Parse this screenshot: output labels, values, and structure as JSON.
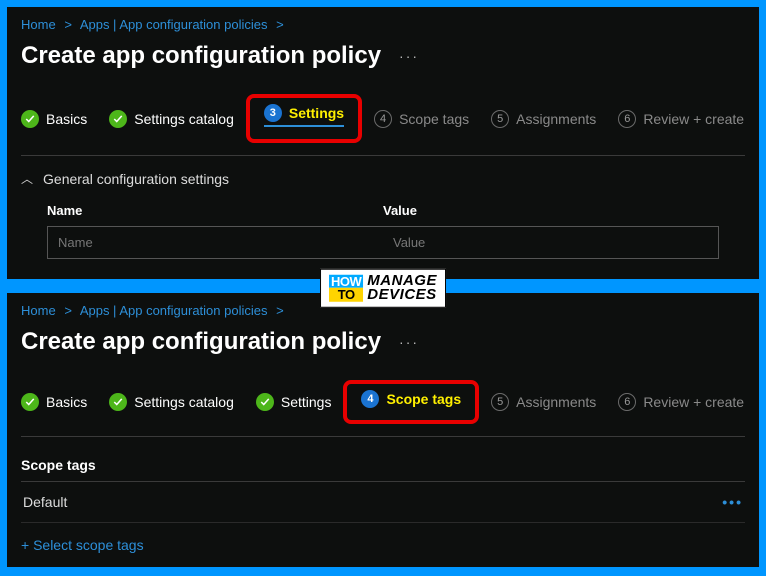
{
  "breadcrumb": {
    "home": "Home",
    "apps": "Apps | App configuration policies"
  },
  "title": "Create app configuration policy",
  "steps": {
    "basics": "Basics",
    "settings_catalog": "Settings catalog",
    "settings": "Settings",
    "scope_tags": "Scope tags",
    "assignments": "Assignments",
    "review_create": "Review + create",
    "num3": "3",
    "num4": "4",
    "num5": "5",
    "num6": "6"
  },
  "panel1": {
    "accordion": "General configuration settings",
    "col_name": "Name",
    "col_value": "Value",
    "name_placeholder": "Name",
    "value_placeholder": "Value"
  },
  "panel2": {
    "section": "Scope tags",
    "tag": "Default",
    "add_link": "+ Select scope tags"
  },
  "watermark": {
    "how": "HOW",
    "to": "TO",
    "manage": "MANAGE",
    "devices": "DEVICES"
  }
}
